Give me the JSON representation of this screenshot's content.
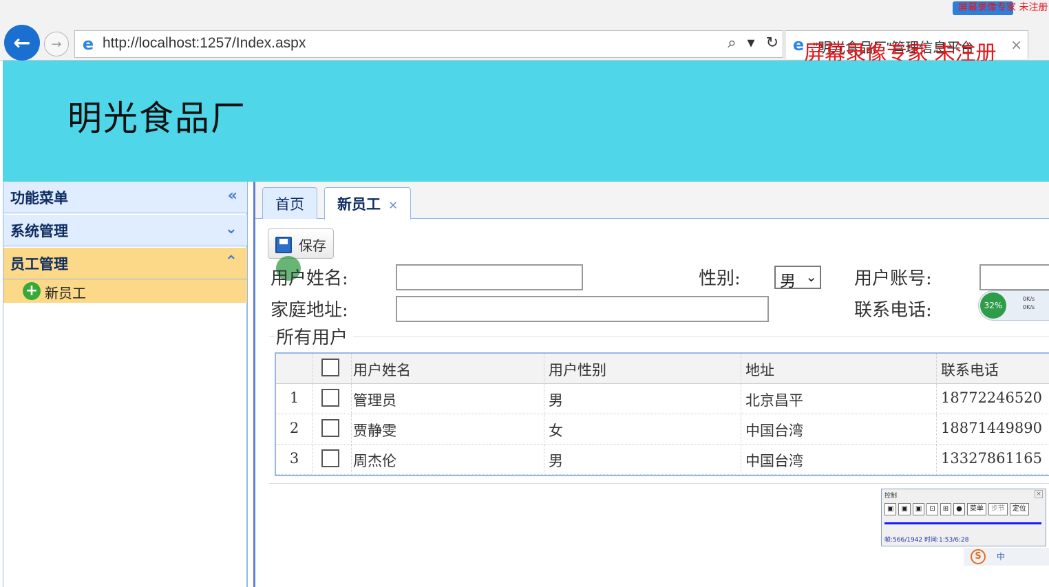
{
  "browser": {
    "url": "http://localhost:1257/Index.aspx",
    "tab_title": "\"明光食品厂\"管理信息平台",
    "watermark": "屏幕录像专家 未注册",
    "watermark_small": "屏幕录像专家 未注册"
  },
  "banner": {
    "title": "明光食品厂",
    "bg_color": "#4fd6e8"
  },
  "sidebar": {
    "menu_title": "功能菜单",
    "sections": [
      {
        "label": "系统管理",
        "expanded": false
      },
      {
        "label": "员工管理",
        "expanded": true
      }
    ],
    "items": [
      {
        "label": "新员工",
        "icon": "plus-icon"
      }
    ]
  },
  "tabs": [
    {
      "label": "首页"
    },
    {
      "label": "新员工",
      "closable": true
    }
  ],
  "toolbar": {
    "save_label": "保存"
  },
  "form": {
    "username_label": "用户姓名:",
    "gender_label": "性别:",
    "gender_value": "男",
    "account_label": "用户账号:",
    "address_label": "家庭地址:",
    "phone_label": "联系电话:"
  },
  "net_widget": {
    "percent": "32%",
    "up": "0K/s",
    "down": "0K/s"
  },
  "grid": {
    "title": "所有用户",
    "columns": [
      "用户姓名",
      "用户性别",
      "地址",
      "联系电话"
    ],
    "rows": [
      {
        "index": "1",
        "name": "管理员",
        "gender": "男",
        "address": "北京昌平",
        "phone": "18772246520"
      },
      {
        "index": "2",
        "name": "贾静雯",
        "gender": "女",
        "address": "中国台湾",
        "phone": "18871449890"
      },
      {
        "index": "3",
        "name": "周杰伦",
        "gender": "男",
        "address": "中国台湾",
        "phone": "13327861165"
      }
    ]
  },
  "recorder": {
    "title": "控制",
    "menu_label": "菜单",
    "step_label": "步节",
    "locate_label": "定位",
    "info": "帧:566/1942 时间:1:53/6:28"
  },
  "tray": {
    "ime": "中"
  }
}
